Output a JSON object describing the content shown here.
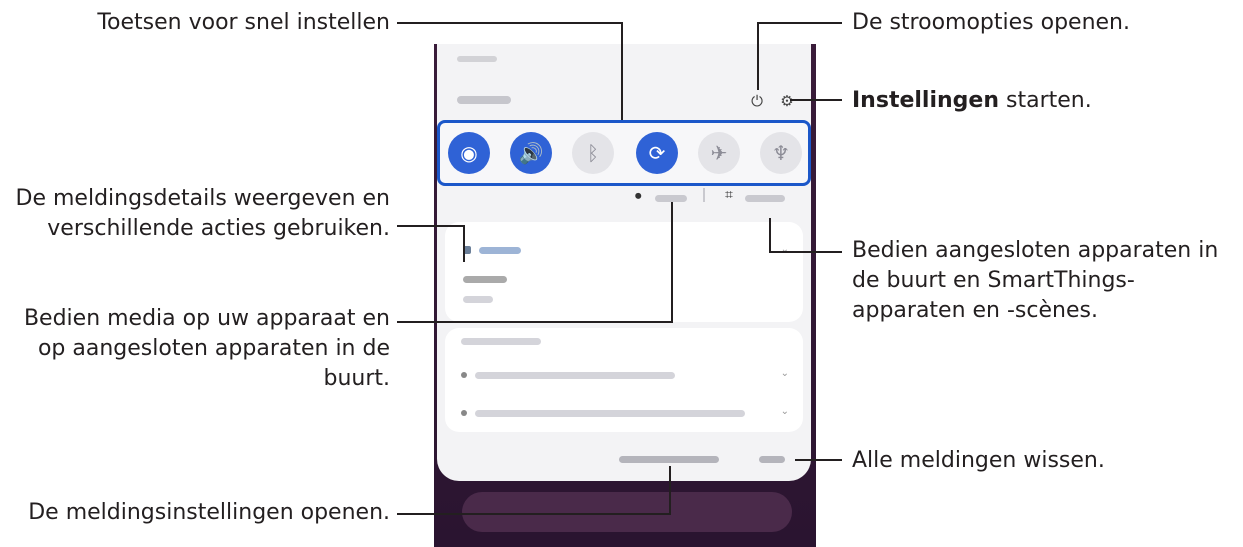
{
  "callouts": {
    "quick_settings": "Toetsen voor snel instellen",
    "power": "De stroomopties openen.",
    "settings_bold": "Instellingen",
    "settings_rest": " starten.",
    "notif_details_1": "De meldingsdetails weergeven en",
    "notif_details_2": "verschillende acties gebruiken.",
    "devices_1": "Bedien aangesloten apparaten in",
    "devices_2": "de buurt en SmartThings-",
    "devices_3": "apparaten en -scènes.",
    "media_1": "Bedien media op uw apparaat en",
    "media_2": "op aangesloten apparaten in de",
    "media_3": "buurt.",
    "clear_all": "Alle meldingen wissen.",
    "notif_settings": "De meldingsinstellingen openen."
  },
  "phone": {
    "quick_buttons": [
      {
        "icon": "wifi-icon",
        "state": "on",
        "glyph": "◉"
      },
      {
        "icon": "sound-icon",
        "state": "on",
        "glyph": "🔊"
      },
      {
        "icon": "bluetooth-icon",
        "state": "off",
        "glyph": "ᛒ"
      },
      {
        "icon": "auto-rotate-icon",
        "state": "on",
        "glyph": "⟳"
      },
      {
        "icon": "airplane-icon",
        "state": "off",
        "glyph": "✈"
      },
      {
        "icon": "flashlight-icon",
        "state": "off",
        "glyph": "♆"
      }
    ],
    "colors": {
      "accent": "#1b57c9",
      "active": "#2f62d6",
      "panel": "#f3f3f5"
    }
  }
}
